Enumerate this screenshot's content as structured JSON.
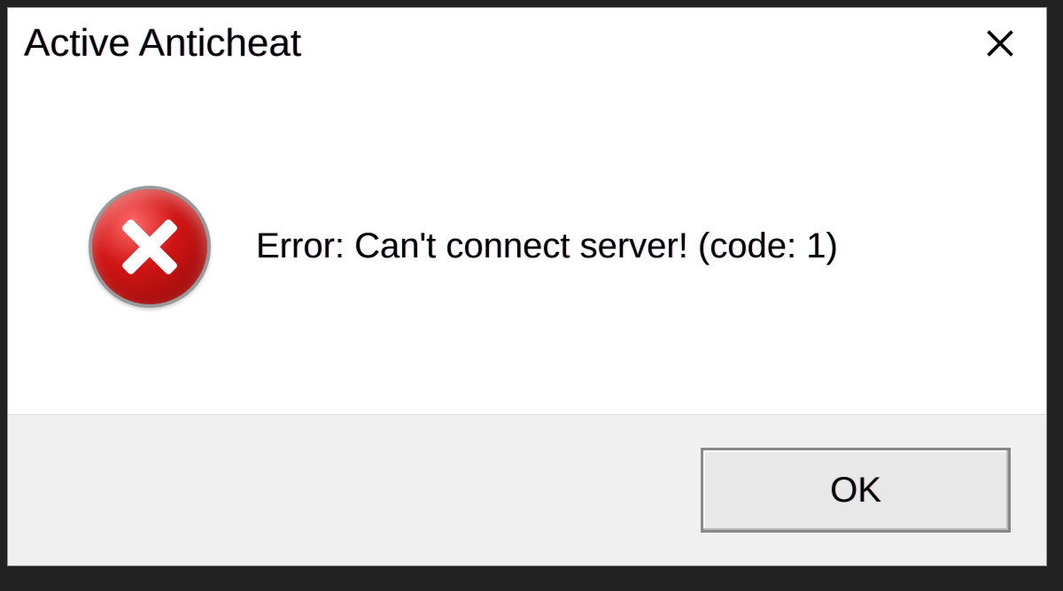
{
  "dialog": {
    "title": "Active Anticheat",
    "message": "Error: Can't connect server! (code: 1)",
    "ok_label": "OK"
  }
}
